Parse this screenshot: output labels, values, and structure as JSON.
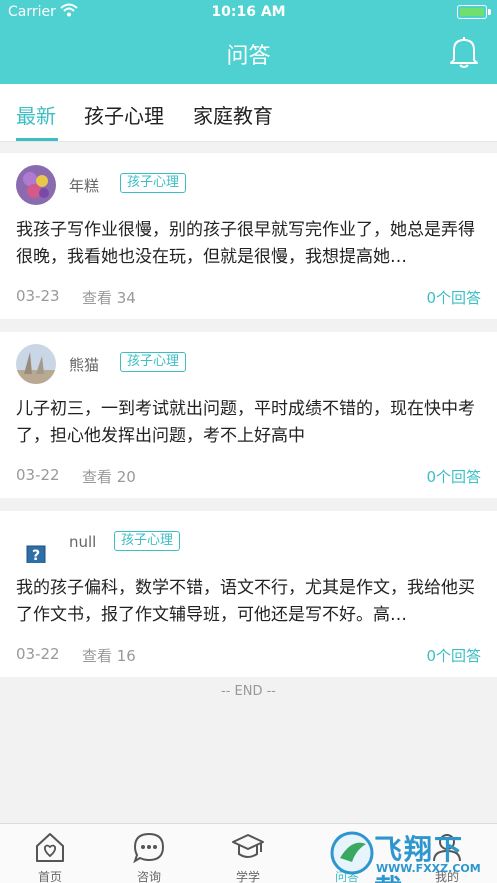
{
  "status_bar": {
    "carrier": "Carrier",
    "time": "10:16 AM"
  },
  "header": {
    "title": "问答"
  },
  "tabs": [
    {
      "label": "最新",
      "active": true
    },
    {
      "label": "孩子心理",
      "active": false
    },
    {
      "label": "家庭教育",
      "active": false
    }
  ],
  "posts": [
    {
      "author": "年糕",
      "tag": "孩子心理",
      "content": "我孩子写作业很慢，别的孩子很早就写完作业了，她总是弄得很晚，我看她也没在玩，但就是很慢，我想提高她…",
      "date": "03-23",
      "views": "查看 34",
      "answers": "0个回答"
    },
    {
      "author": "熊猫",
      "tag": "孩子心理",
      "content": "儿子初三，一到考试就出问题，平时成绩不错的，现在快中考了，担心他发挥出问题，考不上好高中",
      "date": "03-22",
      "views": "查看 20",
      "answers": "0个回答"
    },
    {
      "author": "null",
      "tag": "孩子心理",
      "content": "我的孩子偏科，数学不错，语文不行，尤其是作文，我给他买了作文书，报了作文辅导班，可他还是写不好。高…",
      "date": "03-22",
      "views": "查看 16",
      "answers": "0个回答"
    }
  ],
  "list_end": "-- END --",
  "tabbar": [
    {
      "label": "首页",
      "icon": "home-icon"
    },
    {
      "label": "咨询",
      "icon": "chat-icon"
    },
    {
      "label": "学学",
      "icon": "graduation-cap-icon"
    },
    {
      "label": "问答",
      "icon": "qa-icon",
      "active": true
    },
    {
      "label": "我的",
      "icon": "profile-icon"
    }
  ],
  "watermark": {
    "text": "飞翔下载",
    "url": "WWW.FXXZ.COM"
  },
  "colors": {
    "accent": "#4fd1d1",
    "link": "#3bbfc5",
    "background": "#f2f2f2"
  }
}
